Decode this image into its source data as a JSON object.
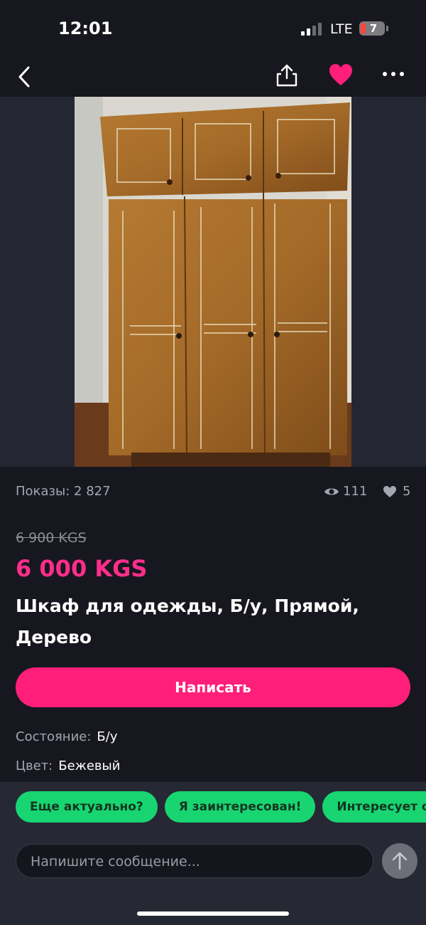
{
  "status_bar": {
    "time": "12:01",
    "network": "LTE",
    "battery": "7"
  },
  "nav": {
    "back_icon": "chevron-left-icon",
    "share_icon": "share-icon",
    "favorite_icon": "heart-filled-icon",
    "more_icon": "more-dots-icon"
  },
  "listing": {
    "views_label": "Показы: 2 827",
    "eye_count": "111",
    "likes_count": "5",
    "old_price": "6 900 KGS",
    "price": "6 000 KGS",
    "title": "Шкаф для одежды, Б/у, Прямой, Дерево",
    "write_button": "Написать",
    "attributes": [
      {
        "key": "Состояние:",
        "value": "Б/у"
      },
      {
        "key": "Цвет:",
        "value": "Бежевый"
      }
    ]
  },
  "quick_replies": [
    "Еще актуально?",
    "Я заинтересован!",
    "Интересует об"
  ],
  "message": {
    "placeholder": "Напишите сообщение..."
  },
  "colors": {
    "accent": "#ff1f7a",
    "price": "#ff2d8a",
    "chip": "#18d572",
    "background": "#17171f"
  }
}
